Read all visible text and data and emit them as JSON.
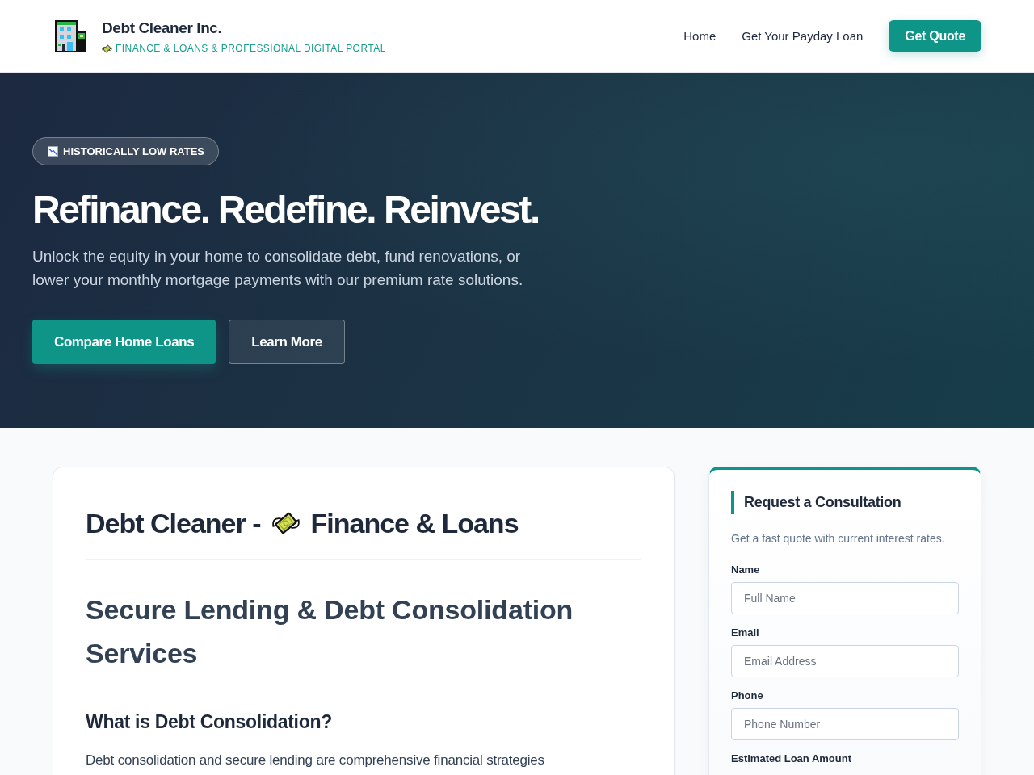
{
  "header": {
    "brand": {
      "name": "Debt Cleaner Inc.",
      "tagline": "FINANCE & LOANS & PROFESSIONAL DIGITAL PORTAL"
    },
    "nav": [
      {
        "label": "Home",
        "kind": "link"
      },
      {
        "label": "Get Your Payday Loan",
        "kind": "link"
      },
      {
        "label": "Get Quote",
        "kind": "button"
      }
    ]
  },
  "hero": {
    "badge": "HISTORICALLY LOW RATES",
    "title": "Refinance. Redefine. Reinvest.",
    "text": "Unlock the equity in your home to consolidate debt, fund renovations, or lower your monthly mortgage payments with our premium rate solutions.",
    "buttons": [
      {
        "label": "Compare Home Loans",
        "kind": "primary"
      },
      {
        "label": "Learn More",
        "kind": "secondary"
      }
    ]
  },
  "article": {
    "title_before_icon": "Debt Cleaner -",
    "title_after_icon": "Finance & Loans",
    "heading": "Secure Lending & Debt Consolidation Services",
    "subheading": "What is Debt Consolidation?",
    "paragraph": "Debt consolidation and secure lending are comprehensive financial strategies"
  },
  "form": {
    "title": "Request a Consultation",
    "subtitle": "Get a fast quote with current interest rates.",
    "fields": [
      {
        "label": "Name",
        "placeholder": "Full Name"
      },
      {
        "label": "Email",
        "placeholder": "Email Address"
      },
      {
        "label": "Phone",
        "placeholder": "Phone Number"
      },
      {
        "label": "Estimated Loan Amount"
      }
    ]
  }
}
